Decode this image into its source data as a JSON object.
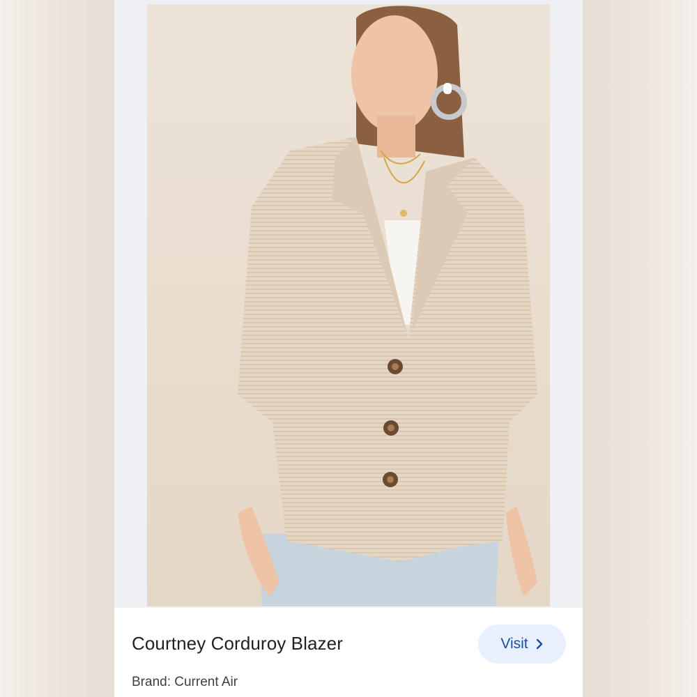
{
  "product": {
    "title": "Courtney Corduroy Blazer",
    "brand": "Brand: Current Air"
  },
  "actions": {
    "visit_label": "Visit",
    "visit_icon": "chevron-right-icon"
  },
  "colors": {
    "button_bg": "#e8f0fe",
    "button_text": "#174ea6",
    "title_text": "#202124",
    "image_backdrop": "#e9ddcf",
    "blazer": "#e4d3c0"
  }
}
